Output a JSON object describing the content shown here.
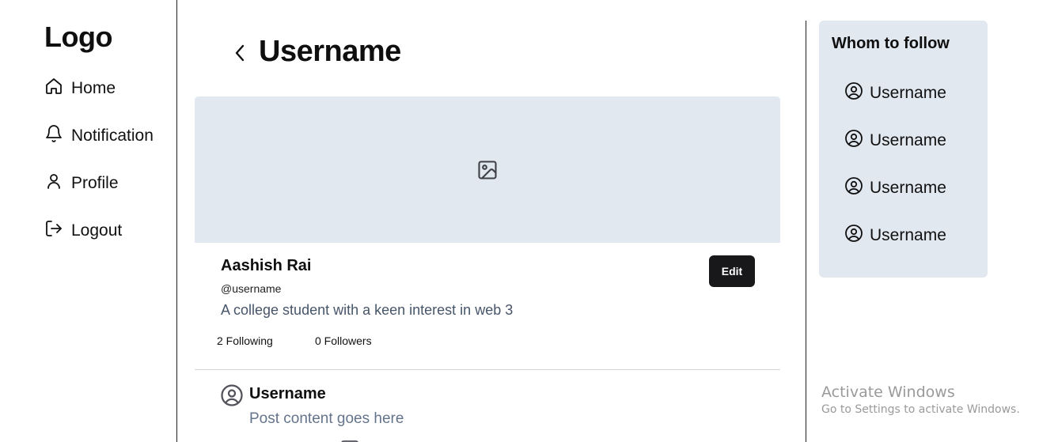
{
  "sidebar": {
    "logo": "Logo",
    "items": [
      {
        "label": "Home",
        "icon": "home-icon"
      },
      {
        "label": "Notification",
        "icon": "bell-icon"
      },
      {
        "label": "Profile",
        "icon": "user-icon"
      },
      {
        "label": "Logout",
        "icon": "logout-icon"
      }
    ]
  },
  "header": {
    "title": "Username",
    "back_icon": "chevron-left-icon"
  },
  "profile": {
    "cover_icon": "image-icon",
    "name": "Aashish Rai",
    "handle": "@username",
    "bio": "A college student with a keen interest in web 3",
    "edit_label": "Edit",
    "following": "2 Following",
    "followers": "0 Followers"
  },
  "post": {
    "username": "Username",
    "content": "Post content goes here",
    "avatar_icon": "user-circle-icon"
  },
  "follow": {
    "title": "Whom to follow",
    "items": [
      {
        "label": "Username",
        "icon": "user-circle-icon"
      },
      {
        "label": "Username",
        "icon": "user-circle-icon"
      },
      {
        "label": "Username",
        "icon": "user-circle-icon"
      },
      {
        "label": "Username",
        "icon": "user-circle-icon"
      }
    ]
  },
  "watermark": {
    "line1": "Activate Windows",
    "line2": "Go to Settings to activate Windows."
  },
  "colors": {
    "accent_bg": "#e2e8f0",
    "button_bg": "#18181b",
    "muted_text": "#64748b"
  }
}
